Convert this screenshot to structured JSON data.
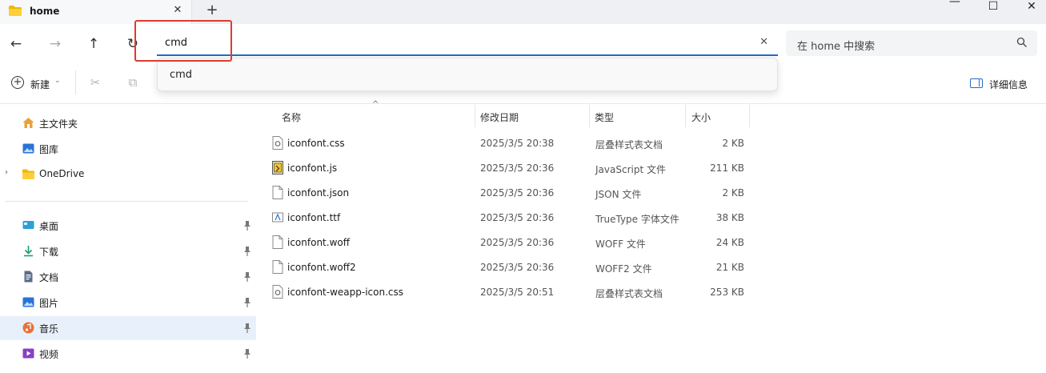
{
  "window": {
    "tab_title": "home",
    "tab_close": "✕",
    "new_tab": "+",
    "minimize": "—",
    "maximize": "☐",
    "close": "✕"
  },
  "nav": {
    "back": "←",
    "forward": "→",
    "up": "↑",
    "refresh": "↻",
    "address_value": "cmd",
    "address_clear": "✕",
    "search_placeholder": "在 home 中搜索"
  },
  "autocomplete": {
    "items": [
      "cmd"
    ]
  },
  "commandbar": {
    "new_label": "新建",
    "new_chevron": "⌄",
    "cut_icon": "✂",
    "copy_icon": "⧉",
    "details_label": "详细信息"
  },
  "sidebar": {
    "items": [
      {
        "label": "主文件夹",
        "icon": "home-icon"
      },
      {
        "label": "图库",
        "icon": "gallery-icon"
      },
      {
        "label": "OneDrive",
        "icon": "folder-icon"
      },
      {
        "label": "桌面",
        "icon": "desktop-icon"
      },
      {
        "label": "下载",
        "icon": "download-icon"
      },
      {
        "label": "文档",
        "icon": "document-icon"
      },
      {
        "label": "图片",
        "icon": "pictures-icon"
      },
      {
        "label": "音乐",
        "icon": "music-icon"
      },
      {
        "label": "视频",
        "icon": "video-icon"
      }
    ],
    "expand_chevron": "›"
  },
  "columns": {
    "name": "名称",
    "modified": "修改日期",
    "type": "类型",
    "size": "大小",
    "sort_arrow": "^"
  },
  "files": [
    {
      "name": "iconfont.css",
      "modified": "2025/3/5 20:38",
      "type": "层叠样式表文档",
      "size": "2 KB",
      "icon": "css-file-icon"
    },
    {
      "name": "iconfont.js",
      "modified": "2025/3/5 20:36",
      "type": "JavaScript 文件",
      "size": "211 KB",
      "icon": "js-file-icon"
    },
    {
      "name": "iconfont.json",
      "modified": "2025/3/5 20:36",
      "type": "JSON 文件",
      "size": "2 KB",
      "icon": "file-icon"
    },
    {
      "name": "iconfont.ttf",
      "modified": "2025/3/5 20:36",
      "type": "TrueType 字体文件",
      "size": "38 KB",
      "icon": "font-file-icon"
    },
    {
      "name": "iconfont.woff",
      "modified": "2025/3/5 20:36",
      "type": "WOFF 文件",
      "size": "24 KB",
      "icon": "file-icon"
    },
    {
      "name": "iconfont.woff2",
      "modified": "2025/3/5 20:36",
      "type": "WOFF2 文件",
      "size": "21 KB",
      "icon": "file-icon"
    },
    {
      "name": "iconfont-weapp-icon.css",
      "modified": "2025/3/5 20:51",
      "type": "层叠样式表文档",
      "size": "253 KB",
      "icon": "css-file-icon"
    }
  ],
  "colors": {
    "accent": "#1f6fc4",
    "highlight": "#e03b2f",
    "folder": "#f2b600"
  }
}
